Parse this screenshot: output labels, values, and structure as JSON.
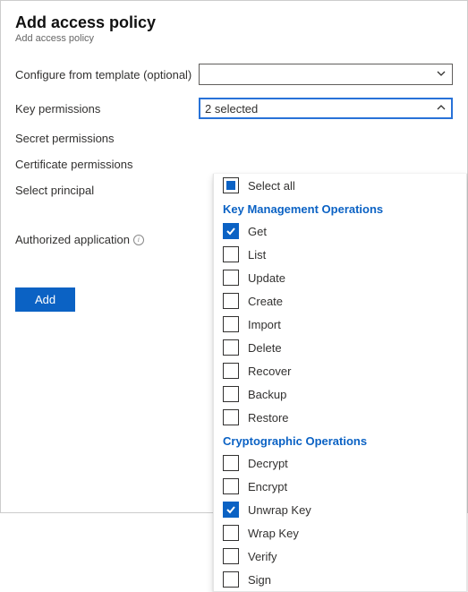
{
  "header": {
    "title": "Add access policy",
    "subtitle": "Add access policy"
  },
  "labels": {
    "configure_template": "Configure from template (optional)",
    "key_permissions": "Key permissions",
    "secret_permissions": "Secret permissions",
    "certificate_permissions": "Certificate permissions",
    "select_principal": "Select principal",
    "authorized_application": "Authorized application"
  },
  "key_permissions_select": {
    "summary": "2 selected",
    "select_all": "Select all",
    "groups": [
      {
        "title": "Key Management Operations",
        "items": [
          {
            "label": "Get",
            "checked": true
          },
          {
            "label": "List",
            "checked": false
          },
          {
            "label": "Update",
            "checked": false
          },
          {
            "label": "Create",
            "checked": false
          },
          {
            "label": "Import",
            "checked": false
          },
          {
            "label": "Delete",
            "checked": false
          },
          {
            "label": "Recover",
            "checked": false
          },
          {
            "label": "Backup",
            "checked": false
          },
          {
            "label": "Restore",
            "checked": false
          }
        ]
      },
      {
        "title": "Cryptographic Operations",
        "items": [
          {
            "label": "Decrypt",
            "checked": false
          },
          {
            "label": "Encrypt",
            "checked": false
          },
          {
            "label": "Unwrap Key",
            "checked": true
          },
          {
            "label": "Wrap Key",
            "checked": false
          },
          {
            "label": "Verify",
            "checked": false
          },
          {
            "label": "Sign",
            "checked": false
          }
        ]
      }
    ]
  },
  "buttons": {
    "add": "Add"
  }
}
